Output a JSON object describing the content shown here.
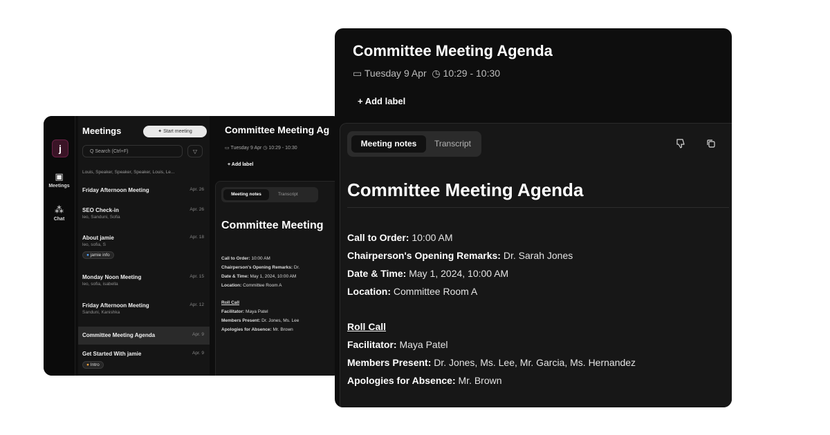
{
  "small_window": {
    "logo_letter": "j",
    "rail": [
      {
        "icon": "calendar-icon",
        "glyph": "▣",
        "label": "Meetings"
      },
      {
        "icon": "chat-icon",
        "glyph": "⁂",
        "label": "Chat"
      }
    ],
    "list": {
      "title": "Meetings",
      "start_button": "✦ Start meeting",
      "search_placeholder": "Q Search (Ctrl+F)",
      "filter_glyph": "▽",
      "participants": "Louis, Speaker, Speaker, Speaker, Louis, Le...",
      "meetings": [
        {
          "title": "Friday Afternoon Meeting",
          "date": "Apr. 26",
          "sub": "",
          "tag": ""
        },
        {
          "title": "SEO Check-in",
          "date": "Apr. 26",
          "sub": "leo, Sanduni, Sofia",
          "tag": ""
        },
        {
          "title": "About jamie",
          "date": "Apr. 18",
          "sub": "leo, sofia, S",
          "tag": "jamie info"
        },
        {
          "title": "Monday Noon Meeting",
          "date": "Apr. 15",
          "sub": "leo, sofia, isabella",
          "tag": ""
        },
        {
          "title": "Friday Afternoon Meeting",
          "date": "Apr. 12",
          "sub": "Sanduni, Kanishka",
          "tag": ""
        },
        {
          "title": "Committee Meeting Agenda",
          "date": "Apr. 9",
          "sub": "",
          "tag": ""
        },
        {
          "title": "Get Started With jamie",
          "date": "Apr. 9",
          "sub": "",
          "tag": "Intro"
        }
      ]
    },
    "detail": {
      "title": "Committee Meeting Ag",
      "date": "Tuesday 9 Apr",
      "time": "10:29 - 10:30",
      "add_label": "+ Add label",
      "tab_notes": "Meeting notes",
      "tab_transcript": "Transcript",
      "notes_title": "Committee Meeting",
      "lines": [
        {
          "key": "Call to Order:",
          "val": "10:00 AM"
        },
        {
          "key": "Chairperson's Opening Remarks:",
          "val": "Dr."
        },
        {
          "key": "Date & Time:",
          "val": "May 1, 2024, 10:00 AM"
        },
        {
          "key": "Location:",
          "val": "Committee Room A"
        },
        {
          "key": "Roll Call",
          "val": ""
        },
        {
          "key": "Facilitator:",
          "val": "Maya Patel"
        },
        {
          "key": "Members Present:",
          "val": "Dr. Jones, Ms. Lee"
        },
        {
          "key": "Apologies for Absence:",
          "val": "Mr. Brown"
        }
      ]
    }
  },
  "big_window": {
    "title": "Committee Meeting Agenda",
    "date": "Tuesday 9 Apr",
    "time": "10:29 - 10:30",
    "add_label": "+ Add label",
    "tab_notes": "Meeting notes",
    "tab_transcript": "Transcript",
    "notes_title": "Committee Meeting Agenda",
    "lines": [
      {
        "key": "Call to Order:",
        "val": "10:00 AM"
      },
      {
        "key": "Chairperson's Opening Remarks:",
        "val": "Dr. Sarah Jones"
      },
      {
        "key": "Date & Time:",
        "val": "May 1, 2024, 10:00 AM"
      },
      {
        "key": "Location:",
        "val": "Committee Room A"
      }
    ],
    "roll_call": "Roll Call",
    "roll_lines": [
      {
        "key": "Facilitator:",
        "val": "Maya Patel"
      },
      {
        "key": "Members Present:",
        "val": "Dr. Jones, Ms. Lee, Mr. Garcia, Ms. Hernandez"
      },
      {
        "key": "Apologies for Absence:",
        "val": "Mr. Brown"
      }
    ]
  },
  "colors": {
    "background": "#ffffff",
    "window": "#0e0e0e",
    "panel": "#171717",
    "accent_blue": "#4fa3ff",
    "accent_orange": "#f2a33a"
  }
}
